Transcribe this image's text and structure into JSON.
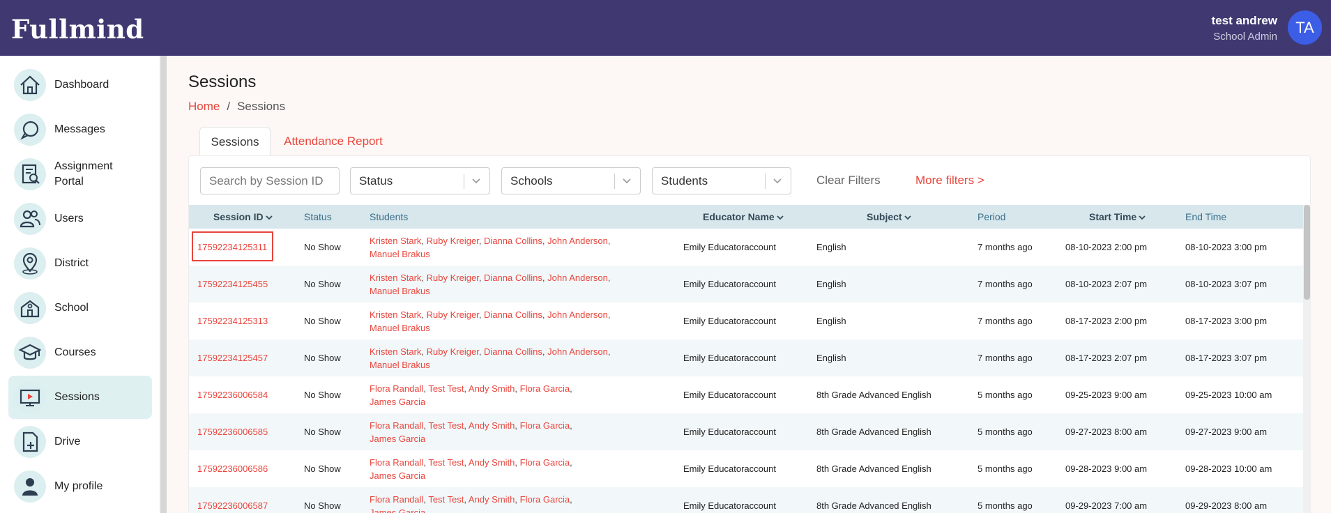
{
  "app": {
    "logo": "Fullmind",
    "user_name": "test andrew",
    "user_role": "School Admin",
    "avatar_initials": "TA"
  },
  "sidebar": {
    "items": [
      {
        "label": "Dashboard",
        "icon": "home-icon"
      },
      {
        "label": "Messages",
        "icon": "messages-icon"
      },
      {
        "label": "Assignment Portal",
        "icon": "assignment-icon"
      },
      {
        "label": "Users",
        "icon": "users-icon"
      },
      {
        "label": "District",
        "icon": "map-pin-icon"
      },
      {
        "label": "School",
        "icon": "school-icon"
      },
      {
        "label": "Courses",
        "icon": "graduation-cap-icon"
      },
      {
        "label": "Sessions",
        "icon": "video-screen-icon",
        "active": true
      },
      {
        "label": "Drive",
        "icon": "drive-file-icon"
      },
      {
        "label": "My profile",
        "icon": "person-icon"
      }
    ]
  },
  "page": {
    "title": "Sessions",
    "breadcrumb": {
      "home": "Home",
      "sep": "/",
      "current": "Sessions"
    }
  },
  "tabs": {
    "sessions": "Sessions",
    "attendance": "Attendance Report"
  },
  "filters": {
    "search_placeholder": "Search by Session ID",
    "status": "Status",
    "schools": "Schools",
    "students": "Students",
    "clear": "Clear Filters",
    "more": "More filters >"
  },
  "table": {
    "headers": {
      "session_id": "Session ID",
      "status": "Status",
      "students": "Students",
      "educator": "Educator Name",
      "subject": "Subject",
      "period": "Period",
      "start": "Start Time",
      "end": "End Time"
    },
    "rows": [
      {
        "id": "17592234125311",
        "status": "No Show",
        "students_line1": [
          "Kristen Stark",
          "Ruby Kreiger",
          "Dianna Collins",
          "John Anderson"
        ],
        "students_line2": "Manuel Brakus",
        "educator": "Emily Educatoraccount",
        "subject": "English",
        "period": "7 months ago",
        "start": "08-10-2023 2:00 pm",
        "end": "08-10-2023 3:00 pm"
      },
      {
        "id": "17592234125455",
        "status": "No Show",
        "students_line1": [
          "Kristen Stark",
          "Ruby Kreiger",
          "Dianna Collins",
          "John Anderson"
        ],
        "students_line2": "Manuel Brakus",
        "educator": "Emily Educatoraccount",
        "subject": "English",
        "period": "7 months ago",
        "start": "08-10-2023 2:07 pm",
        "end": "08-10-2023 3:07 pm"
      },
      {
        "id": "17592234125313",
        "status": "No Show",
        "students_line1": [
          "Kristen Stark",
          "Ruby Kreiger",
          "Dianna Collins",
          "John Anderson"
        ],
        "students_line2": "Manuel Brakus",
        "educator": "Emily Educatoraccount",
        "subject": "English",
        "period": "7 months ago",
        "start": "08-17-2023 2:00 pm",
        "end": "08-17-2023 3:00 pm"
      },
      {
        "id": "17592234125457",
        "status": "No Show",
        "students_line1": [
          "Kristen Stark",
          "Ruby Kreiger",
          "Dianna Collins",
          "John Anderson"
        ],
        "students_line2": "Manuel Brakus",
        "educator": "Emily Educatoraccount",
        "subject": "English",
        "period": "7 months ago",
        "start": "08-17-2023 2:07 pm",
        "end": "08-17-2023 3:07 pm"
      },
      {
        "id": "17592236006584",
        "status": "No Show",
        "students_line1": [
          "Flora Randall",
          "Test Test",
          "Andy Smith",
          "Flora Garcia"
        ],
        "students_line2": "James Garcia",
        "educator": "Emily Educatoraccount",
        "subject": "8th Grade Advanced English",
        "period": "5 months ago",
        "start": "09-25-2023 9:00 am",
        "end": "09-25-2023 10:00 am"
      },
      {
        "id": "17592236006585",
        "status": "No Show",
        "students_line1": [
          "Flora Randall",
          "Test Test",
          "Andy Smith",
          "Flora Garcia"
        ],
        "students_line2": "James Garcia",
        "educator": "Emily Educatoraccount",
        "subject": "8th Grade Advanced English",
        "period": "5 months ago",
        "start": "09-27-2023 8:00 am",
        "end": "09-27-2023 9:00 am"
      },
      {
        "id": "17592236006586",
        "status": "No Show",
        "students_line1": [
          "Flora Randall",
          "Test Test",
          "Andy Smith",
          "Flora Garcia"
        ],
        "students_line2": "James Garcia",
        "educator": "Emily Educatoraccount",
        "subject": "8th Grade Advanced English",
        "period": "5 months ago",
        "start": "09-28-2023 9:00 am",
        "end": "09-28-2023 10:00 am"
      },
      {
        "id": "17592236006587",
        "status": "No Show",
        "students_line1": [
          "Flora Randall",
          "Test Test",
          "Andy Smith",
          "Flora Garcia"
        ],
        "students_line2": "James Garcia",
        "educator": "Emily Educatoraccount",
        "subject": "8th Grade Advanced English",
        "period": "5 months ago",
        "start": "09-29-2023 7:00 am",
        "end": "09-29-2023 8:00 am"
      }
    ]
  },
  "colors": {
    "topbar": "#403871",
    "accent": "#e8453c",
    "sidebar_active": "#dff0f1",
    "table_header": "#d7e7ec",
    "avatar": "#3c5ee6"
  }
}
